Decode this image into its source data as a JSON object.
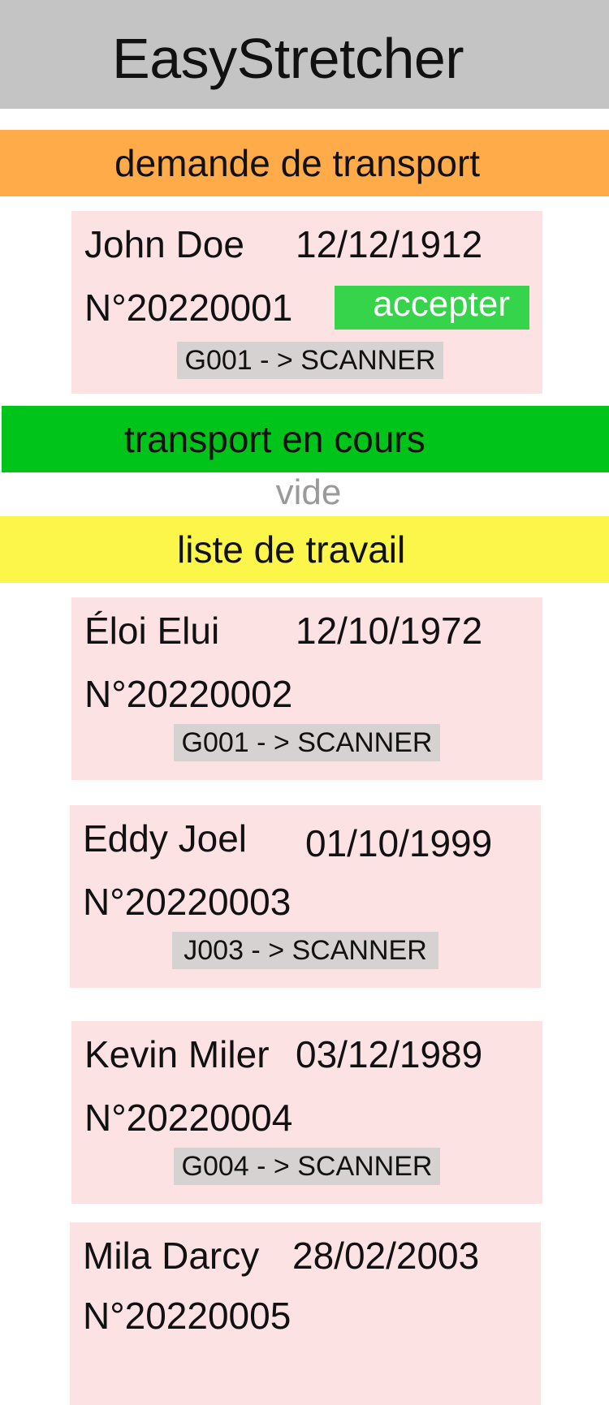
{
  "app": {
    "title": "EasyStretcher"
  },
  "sections": {
    "requests": "demande de transport",
    "current": "transport en cours",
    "current_empty": "vide",
    "worklist": "liste de travail"
  },
  "request": {
    "name": "John Doe",
    "dob": "12/12/1912",
    "number": "N°20220001",
    "accept_label": "accepter",
    "route": "G001 - > SCANNER"
  },
  "worklist": [
    {
      "name": "Éloi Elui",
      "dob": "12/10/1972",
      "number": "N°20220002",
      "route": "G001 - > SCANNER"
    },
    {
      "name": "Eddy Joel",
      "dob": "01/10/1999",
      "number": "N°20220003",
      "route": "J003 - > SCANNER"
    },
    {
      "name": "Kevin Miler",
      "dob": "03/12/1989",
      "number": "N°20220004",
      "route": "G004 - > SCANNER"
    },
    {
      "name": "Mila Darcy",
      "dob": "28/02/2003",
      "number": "N°20220005"
    }
  ],
  "colors": {
    "header": "#c4c4c4",
    "requests_bar": "#ffab4a",
    "current_bar": "#00c41a",
    "worklist_bar": "#fcf54a",
    "card": "#fce2e2",
    "accept_button": "#36d44a",
    "route_chip": "#d6d2d2"
  }
}
